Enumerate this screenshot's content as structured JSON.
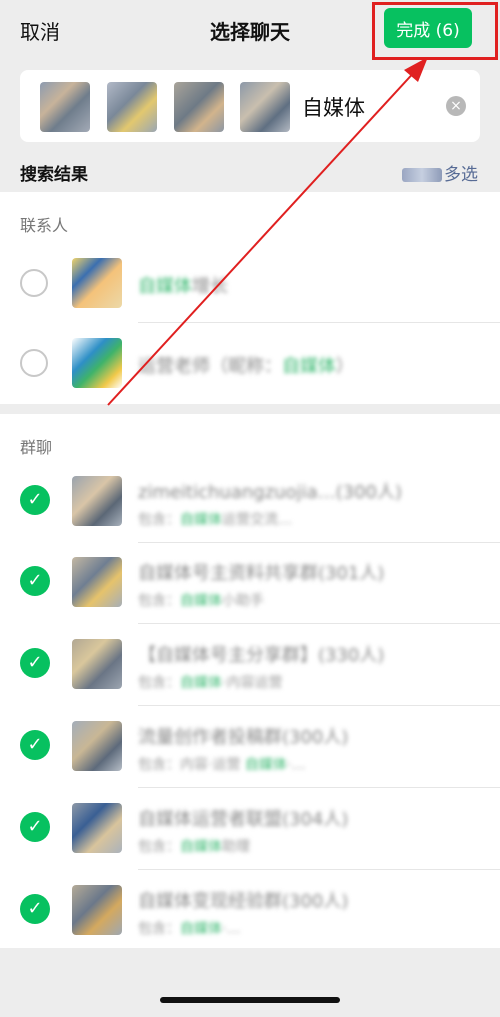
{
  "header": {
    "cancel_label": "取消",
    "title": "选择聊天",
    "done_label": "完成 (6)"
  },
  "search": {
    "query": "自媒体",
    "clear_icon": "clear-icon"
  },
  "results": {
    "title": "搜索结果",
    "multi_select_label": "多选"
  },
  "contacts": {
    "label": "联系人",
    "items": [
      {
        "name_hl": "自媒体",
        "name_rest": "增长"
      },
      {
        "name_pre": "运营老师（昵称：",
        "name_hl": "自媒体",
        "name_rest": "）"
      }
    ]
  },
  "groups": {
    "label": "群聊",
    "items": [
      {
        "name": "zimeitichuangzuojia…(300人)",
        "sub_pre": "包含：",
        "sub_hl": "自媒体",
        "sub_rest": "运营交流…"
      },
      {
        "name": "自媒体号主资料共享群(301人)",
        "sub_pre": "包含：",
        "sub_hl": "自媒体",
        "sub_rest": "小助手"
      },
      {
        "name": "【自媒体号主分享群】(330人)",
        "sub_pre": "包含：",
        "sub_hl": "自媒体",
        "sub_rest": "·内容运营"
      },
      {
        "name": "流量创作者投稿群(300人)",
        "sub_pre": "包含：内容·运营 ",
        "sub_hl": "自媒体",
        "sub_rest": "·…"
      },
      {
        "name": "自媒体运营者联盟(304人)",
        "sub_pre": "包含：",
        "sub_hl": "自媒体",
        "sub_rest": "助理"
      },
      {
        "name": "自媒体变现经验群(300人)",
        "sub_pre": "包含：",
        "sub_hl": "自媒体",
        "sub_rest": "·…"
      }
    ]
  },
  "colors": {
    "accent": "#07c160",
    "highlight_box": "#e02020",
    "link": "#576b95"
  }
}
